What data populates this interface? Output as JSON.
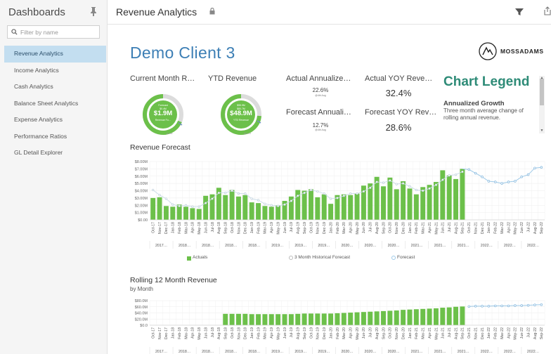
{
  "sidebar": {
    "title": "Dashboards",
    "filter_placeholder": "Filter by name",
    "items": [
      {
        "label": "Revenue Analytics",
        "active": true
      },
      {
        "label": "Income Analytics"
      },
      {
        "label": "Cash Analytics"
      },
      {
        "label": "Balance Sheet Analytics"
      },
      {
        "label": "Expense Analytics"
      },
      {
        "label": "Performance Ratios"
      },
      {
        "label": "GL Detail Explorer"
      }
    ]
  },
  "header": {
    "title": "Revenue Analytics",
    "icons": [
      "lock-icon",
      "funnel-icon",
      "export-icon"
    ]
  },
  "client_title": "Demo Client 3",
  "logo": {
    "text": "MOSSADAMS"
  },
  "kpis": {
    "current_month": {
      "label": "Current Month R…",
      "gauge_caption": "Forecast",
      "gauge_sub": "$0.4M",
      "value": "$1.9M",
      "gauge_note": "Revenue Fo…",
      "foot": "$0.4M"
    },
    "ytd": {
      "label": "YTD Revenue",
      "gauge_caption": "$55.9M",
      "gauge_sub": "$80.7M",
      "value": "$48.9M",
      "gauge_note": "YTD Revenue",
      "foot": "$80.7M"
    },
    "actual_annualized": {
      "label": "Actual Annualize…",
      "value": "22.6%",
      "note": "@4th Aug"
    },
    "actual_yoy": {
      "label": "Actual YOY Reve…",
      "value": "32.4%"
    },
    "forecast_annualized": {
      "label": "Forecast Annuali…",
      "value": "12.7%",
      "note": "@4th Aug"
    },
    "forecast_yoy": {
      "label": "Forecast YOY Rev…",
      "value": "28.6%"
    }
  },
  "legend_panel": {
    "title": "Chart Legend",
    "subtitle": "Annualized Growth",
    "description": "Three month average change of rolling annual revenue."
  },
  "colors": {
    "bar_green": "#6cc04a",
    "line_blue": "#9ecae8",
    "title_blue": "#3d7fb5",
    "legend_teal": "#2e8b77"
  },
  "chart_data": [
    {
      "type": "bar",
      "title": "Revenue Forecast",
      "categories": [
        "Oct-17",
        "Nov-17",
        "Dec-17",
        "Jan-18",
        "Feb-18",
        "Mar-18",
        "Apr-18",
        "May-18",
        "Jun-18",
        "Jul-18",
        "Aug-18",
        "Sep-18",
        "Oct-18",
        "Nov-18",
        "Dec-18",
        "Jan-19",
        "Feb-19",
        "Mar-19",
        "Apr-19",
        "May-19",
        "Jun-19",
        "Jul-19",
        "Aug-19",
        "Sep-19",
        "Oct-19",
        "Nov-19",
        "Dec-19",
        "Jan-20",
        "Feb-20",
        "Mar-20",
        "Apr-20",
        "May-20",
        "Jun-20",
        "Jul-20",
        "Aug-20",
        "Sep-20",
        "Oct-20",
        "Nov-20",
        "Dec-20",
        "Jan-21",
        "Feb-21",
        "Mar-21",
        "Apr-21",
        "May-21",
        "Jun-21",
        "Jul-21",
        "Aug-21",
        "Sep-21",
        "Oct-21",
        "Nov-21",
        "Dec-21",
        "Jan-22",
        "Feb-22",
        "Mar-22",
        "Apr-22",
        "May-22",
        "Jun-22",
        "Jul-22",
        "Aug-22",
        "Sep-22"
      ],
      "year_labels": [
        "2017…",
        "2018…",
        "2018…",
        "2018…",
        "2018…",
        "2019…",
        "2019…",
        "2019…",
        "2020…",
        "2020…",
        "2020…",
        "2021…",
        "2021…",
        "2021…",
        "2022…",
        "2022…",
        "2022…"
      ],
      "yticks": [
        "$8.00M",
        "$7.00M",
        "$6.00M",
        "$5.00M",
        "$4.00M",
        "$3.00M",
        "$2.00M",
        "$1.00M",
        "$0.00"
      ],
      "ylim": [
        0,
        8
      ],
      "series": [
        {
          "name": "Actuals",
          "values": [
            3.0,
            3.1,
            1.9,
            1.8,
            2.1,
            1.8,
            1.6,
            1.5,
            3.3,
            3.5,
            4.4,
            3.4,
            4.1,
            3.2,
            3.4,
            2.4,
            2.3,
            1.9,
            1.8,
            2.0,
            2.6,
            3.2,
            4.1,
            4.0,
            4.2,
            3.1,
            3.5,
            2.2,
            3.4,
            3.5,
            3.4,
            3.6,
            4.7,
            5.0,
            5.9,
            4.6,
            5.8,
            4.2,
            5.3,
            4.3,
            3.5,
            4.5,
            4.8,
            5.2,
            6.8,
            6.1,
            5.6,
            7.0
          ]
        },
        {
          "name": "3 Month Historical Forecast",
          "values": [
            4.1,
            3.4,
            2.9,
            2.1,
            1.9,
            2.0,
            1.8,
            1.8,
            2.3,
            2.9,
            3.7,
            3.7,
            4.0,
            3.6,
            3.6,
            2.9,
            2.7,
            2.2,
            2.0,
            1.9,
            2.1,
            2.6,
            3.3,
            3.7,
            4.1,
            3.9,
            3.6,
            2.9,
            3.0,
            3.3,
            3.6,
            3.6,
            3.9,
            4.4,
            5.2,
            5.1,
            5.4,
            4.9,
            5.0,
            4.6,
            4.1,
            4.0,
            4.3,
            4.8,
            5.5,
            6.1,
            6.2,
            6.6
          ]
        },
        {
          "name": "Forecast",
          "values": [
            6.9,
            6.4,
            5.9,
            5.3,
            5.2,
            5.0,
            5.2,
            5.3,
            5.9,
            6.2,
            7.1,
            7.2
          ]
        }
      ]
    },
    {
      "type": "bar",
      "title": "Rolling 12 Month Revenue",
      "subtitle": "by Month",
      "categories": [
        "Oct-17",
        "Nov-17",
        "Dec-17",
        "Jan-18",
        "Feb-18",
        "Mar-18",
        "Apr-18",
        "May-18",
        "Jun-18",
        "Jul-18",
        "Aug-18",
        "Sep-18",
        "Oct-18",
        "Nov-18",
        "Dec-18",
        "Jan-19",
        "Feb-19",
        "Mar-19",
        "Apr-19",
        "May-19",
        "Jun-19",
        "Jul-19",
        "Aug-19",
        "Sep-19",
        "Oct-19",
        "Nov-19",
        "Dec-19",
        "Jan-20",
        "Feb-20",
        "Mar-20",
        "Apr-20",
        "May-20",
        "Jun-20",
        "Jul-20",
        "Aug-20",
        "Sep-20",
        "Oct-20",
        "Nov-20",
        "Dec-20",
        "Jan-21",
        "Feb-21",
        "Mar-21",
        "Apr-21",
        "May-21",
        "Jun-21",
        "Jul-21",
        "Aug-21",
        "Sep-21",
        "Oct-21",
        "Nov-21",
        "Dec-21",
        "Jan-22",
        "Feb-22",
        "Mar-22",
        "Apr-22",
        "May-22",
        "Jun-22",
        "Jul-22",
        "Aug-22",
        "Sep-22"
      ],
      "year_labels": [
        "2017…",
        "2018…",
        "2018…",
        "2018…",
        "2018…",
        "2019…",
        "2019…",
        "2019…",
        "2020…",
        "2020…",
        "2020…",
        "2021…",
        "2021…",
        "2021…",
        "2022…",
        "2022…",
        "2022…"
      ],
      "yticks": [
        "$80.0M",
        "$60.0M",
        "$40.0M",
        "$20.0M",
        "$0.0"
      ],
      "ylim": [
        0,
        80
      ],
      "series": [
        {
          "name": "Actuals",
          "values": [
            0,
            0,
            0,
            0,
            0,
            0,
            0,
            0,
            0,
            0,
            0,
            37,
            37,
            37,
            37,
            36,
            36,
            36,
            36,
            36,
            36,
            36,
            37,
            38,
            38,
            38,
            38,
            38,
            39,
            40,
            41,
            42,
            43,
            44,
            45,
            46,
            47,
            48,
            50,
            51,
            52,
            53,
            54,
            55,
            57,
            58,
            60,
            61
          ]
        },
        {
          "name": "Forecast",
          "values": [
            61,
            62,
            62,
            62,
            63,
            63,
            63,
            64,
            64,
            65,
            66,
            67
          ]
        }
      ]
    }
  ],
  "legend_items": [
    "Actuals",
    "3 Month Historical Forecast",
    "Forecast"
  ]
}
